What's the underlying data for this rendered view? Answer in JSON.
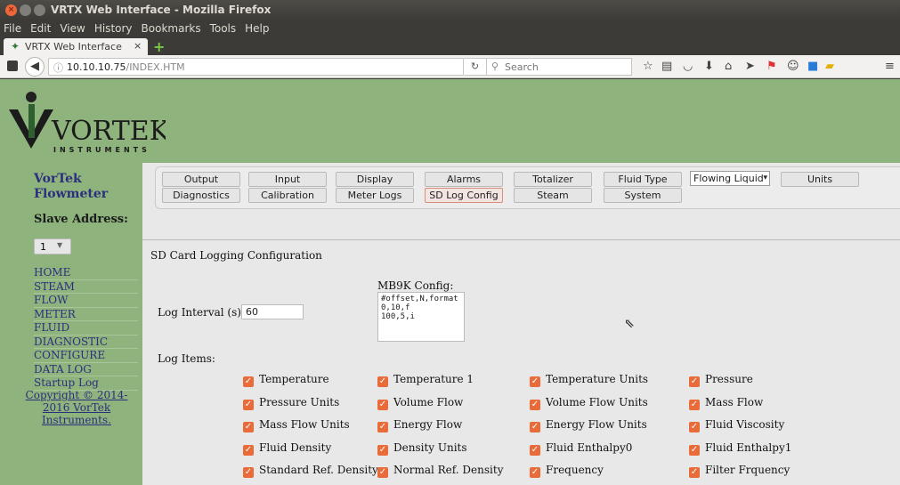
{
  "window": {
    "title": "VRTX Web Interface - Mozilla Firefox"
  },
  "menubar": [
    "File",
    "Edit",
    "View",
    "History",
    "Bookmarks",
    "Tools",
    "Help"
  ],
  "tab": {
    "label": "VRTX Web Interface",
    "close": "×",
    "new_tab": "+"
  },
  "nav": {
    "url_host": "10.10.10.75",
    "url_path": "/INDEX.HTM",
    "search_placeholder": "Search",
    "toolbar_icons": [
      "star-icon",
      "reading-list-icon",
      "pocket-icon",
      "download-icon",
      "home-icon",
      "send-icon",
      "pdf-icon",
      "chat-icon",
      "extension-icon",
      "folder-icon",
      "menu-icon"
    ]
  },
  "sidebar": {
    "brand": "VorTek Flowmeter",
    "slave_label": "Slave Address:",
    "slave_value": "1",
    "links": [
      "HOME",
      "STEAM",
      "FLOW",
      "METER",
      "FLUID",
      "DIAGNOSTIC",
      "CONFIGURE",
      "DATA LOG",
      "Startup Log"
    ],
    "copyright": "Copyright © 2014-2016 VorTek Instruments."
  },
  "logo": {
    "text": "VORTEK",
    "subtext": "INSTRUMENTS"
  },
  "buttons": {
    "row1": [
      "Output",
      "Input",
      "Display",
      "Alarms",
      "Totalizer",
      "Fluid Type"
    ],
    "row2": [
      "Diagnostics",
      "Calibration",
      "Meter Logs",
      "SD Log Config",
      "Steam",
      "System"
    ],
    "active": "SD Log Config",
    "fluid_select": "Flowing Liquid",
    "units_button": "Units"
  },
  "form": {
    "section_title": "SD Card Logging Configuration",
    "mb9k_label": "MB9K Config:",
    "mb9k_text": "#offset,N,format\n0,10,f\n100,5,i",
    "log_interval_label": "Log Interval (s)",
    "log_interval_value": "60",
    "log_items_label": "Log Items:"
  },
  "log_items": [
    [
      "Temperature",
      "Temperature 1",
      "Temperature Units",
      "Pressure"
    ],
    [
      "Pressure Units",
      "Volume Flow",
      "Volume Flow Units",
      "Mass Flow"
    ],
    [
      "Mass Flow Units",
      "Energy Flow",
      "Energy Flow Units",
      "Fluid Viscosity"
    ],
    [
      "Fluid Density",
      "Density Units",
      "Fluid Enthalpy0",
      "Fluid Enthalpy1"
    ],
    [
      "Standard Ref. Density",
      "Normal Ref. Density",
      "Frequency",
      "Filter Frquency"
    ]
  ]
}
